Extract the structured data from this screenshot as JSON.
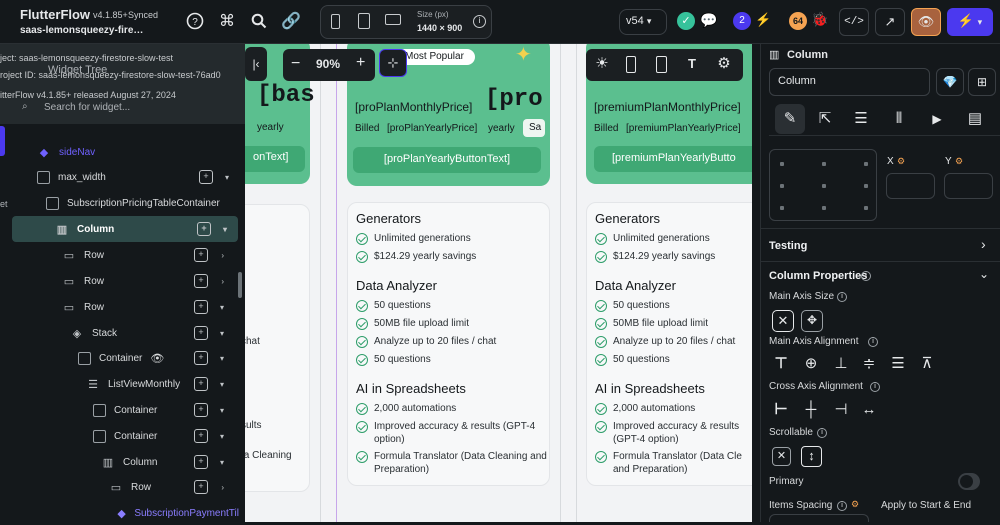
{
  "app": {
    "name": "FlutterFlow",
    "version": "v4.1.85+",
    "sync_status": "Synced",
    "project_name": "saas-lemonsqueezy-firestore-slow-test"
  },
  "toolbar": {
    "size_label": "Size (px)",
    "size_value": "1440 × 900",
    "version_select": "v54",
    "badge_count": "2",
    "warning_count": "64"
  },
  "canvas_controls": {
    "zoom": "90%"
  },
  "left_panel": {
    "ghost_project": "ject: saas-lemonsqueezy-firestore-slow-test",
    "ghost_project2": "roject ID: saas-lemonsqueezy-firestore-slow-test-76ad0",
    "ghost_version": "itterFlow v4.1.85+ released August 27, 2024",
    "ghost_widget_tree": "Widget Tree",
    "search_placeholder": "Search for widget...",
    "ghost_prefix": "et",
    "tree": [
      {
        "label": "sideNav"
      },
      {
        "label": "max_width"
      },
      {
        "label": "SubscriptionPricingTableContainer"
      },
      {
        "label": "Column"
      },
      {
        "label": "Row"
      },
      {
        "label": "Row"
      },
      {
        "label": "Row"
      },
      {
        "label": "Stack"
      },
      {
        "label": "Container"
      },
      {
        "label": "ListViewMonthly"
      },
      {
        "label": "Container"
      },
      {
        "label": "Container"
      },
      {
        "label": "Column"
      },
      {
        "label": "Row"
      },
      {
        "label": "SubscriptionPaymentTil"
      }
    ]
  },
  "canvas": {
    "left_partial": {
      "big_text": "[bas",
      "billed": "yearly",
      "button": "onText]",
      "partial_lines": [
        "chat",
        "sults",
        "ta Cleaning"
      ]
    },
    "pro": {
      "badge": "Most Popular",
      "price_text": "[proPlanMonthlyPrice]",
      "big_text": "[pro",
      "billed_label": "Billed",
      "billed_price": "[proPlanYearlyPrice]",
      "billed_period": "yearly",
      "save_label": "Sa",
      "button": "[proPlanYearlyButtonText]"
    },
    "premium": {
      "price_text": "[premiumPlanMonthlyPrice]",
      "billed_label": "Billed",
      "billed_price": "[premiumPlanYearlyPrice]",
      "billed_period": "yearly",
      "button": "[premiumPlanYearlyButto"
    },
    "sections": [
      {
        "heading": "Generators",
        "items": [
          "Unlimited generations",
          "$124.29 yearly savings"
        ]
      },
      {
        "heading": "Data Analyzer",
        "items": [
          "50 questions",
          "50MB file upload limit",
          "Analyze up to 20 files / chat",
          "50 questions"
        ]
      },
      {
        "heading": "AI in Spreadsheets",
        "items": [
          "2,000 automations",
          "Improved accuracy & results (GPT-4 option)",
          "Formula Translator (Data Cleaning and Preparation)"
        ]
      }
    ],
    "premium_sections": [
      {
        "heading": "Generators",
        "items": [
          "Unlimited generations",
          "$124.29 yearly savings"
        ]
      },
      {
        "heading": "Data Analyzer",
        "items": [
          "50 questions",
          "50MB file upload limit",
          "Analyze up to 20 files / chat",
          "50 questions"
        ]
      },
      {
        "heading": "AI in Spreadsheets",
        "items": [
          "2,000 automations",
          "Improved accuracy & results (GPT-4 option)",
          "Formula Translator (Data Cle and Preparation)"
        ]
      }
    ]
  },
  "right_panel": {
    "widget_type": "Column",
    "widget_name": "Column",
    "x_label": "X",
    "y_label": "Y",
    "testing": "Testing",
    "properties": "Column Properties",
    "main_axis_size": "Main Axis Size",
    "main_axis_alignment": "Main Axis Alignment",
    "cross_axis_alignment": "Cross Axis Alignment",
    "scrollable": "Scrollable",
    "primary": "Primary",
    "items_spacing": "Items Spacing",
    "apply_start_end": "Apply to Start & End"
  },
  "colors": {
    "accent": "#4b39ef",
    "brand_green": "#5bbf8f",
    "selection": "#2e4a49",
    "warning": "#f5a352",
    "success": "#36c29b",
    "badge": "#4b39ef"
  }
}
